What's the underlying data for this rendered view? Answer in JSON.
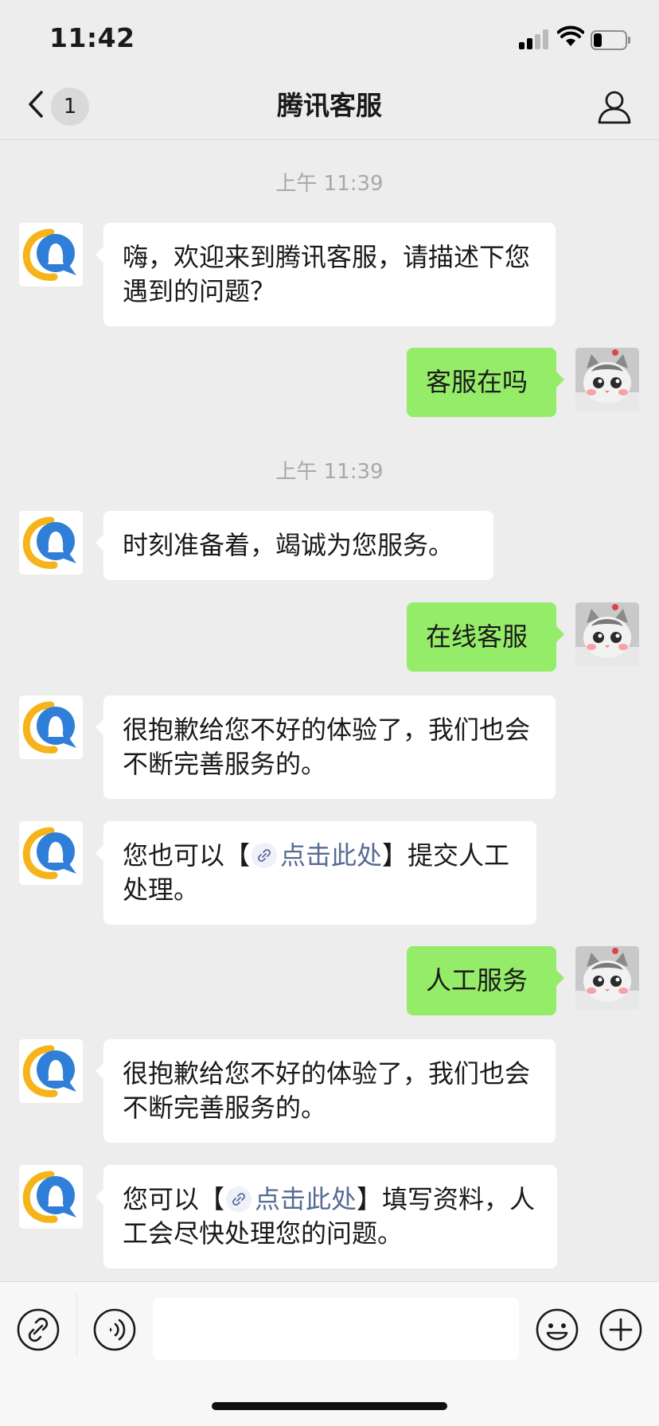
{
  "status_bar": {
    "time": "11:42",
    "signal_bars": 4,
    "signal_bars_active": 2
  },
  "nav": {
    "back_badge": "1",
    "title": "腾讯客服"
  },
  "messages": [
    {
      "type": "time",
      "text": "上午 11:39"
    },
    {
      "type": "bot",
      "text": "嗨，欢迎来到腾讯客服，请描述下您遇到的问题？"
    },
    {
      "type": "user",
      "text": "客服在吗"
    },
    {
      "type": "time",
      "text": "上午 11:39"
    },
    {
      "type": "bot",
      "text": "时刻准备着，竭诚为您服务。"
    },
    {
      "type": "user",
      "text": "在线客服"
    },
    {
      "type": "bot",
      "text": "很抱歉给您不好的体验了，我们也会不断完善服务的。"
    },
    {
      "type": "bot",
      "before": "您也可以【",
      "link": "点击此处",
      "after": "】提交人工处理。"
    },
    {
      "type": "user",
      "text": "人工服务"
    },
    {
      "type": "bot",
      "text": "很抱歉给您不好的体验了，我们也会不断完善服务的。"
    },
    {
      "type": "bot",
      "before": "您可以【",
      "link": "点击此处",
      "after": "】填写资料，人工会尽快处理您的问题。"
    }
  ],
  "input": {
    "placeholder": ""
  },
  "colors": {
    "background": "#ededed",
    "user_bubble": "#95ec69",
    "bot_bubble": "#ffffff",
    "link": "#576b95"
  },
  "icons": [
    "signal-icon",
    "wifi-icon",
    "battery-icon",
    "back-arrow-icon",
    "person-icon",
    "tencent-qq-avatar-icon",
    "cat-avatar",
    "link-icon",
    "voice-icon",
    "emoji-icon",
    "plus-icon"
  ]
}
